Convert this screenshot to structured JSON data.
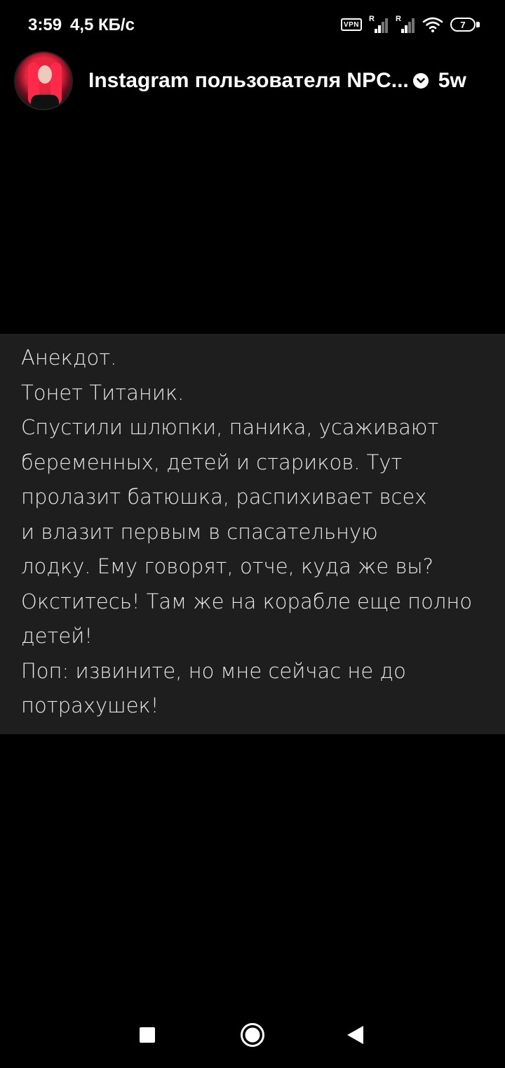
{
  "status_bar": {
    "time": "3:59",
    "speed": "4,5 КБ/с",
    "vpn_label": "VPN",
    "sim1_label": "R",
    "sim2_label": "R",
    "battery": "7"
  },
  "story": {
    "user": "Instagram пользователя NPC...",
    "age": "5w",
    "lines": [
      "Анекдот.",
      "Тонет Титаник.",
      "Спустили шлюпки, паника, усаживают",
      "беременных, детей и стариков. Тут",
      "пролазит батюшка, распихивает всех",
      "и влазит первым в спасательную",
      "лодку. Ему говорят, отче, куда же вы?",
      "Окститесь! Там же на корабле еще полно",
      "детей!",
      "Поп: извините, но мне сейчас не до",
      "потрахушек!"
    ]
  },
  "colors": {
    "background": "#000000",
    "panel": "#1e1e1e",
    "text": "#e6e6e6"
  },
  "icons": {
    "verified": "verified-badge-icon",
    "recents": "square-recents-icon",
    "home": "circle-home-icon",
    "back": "triangle-back-icon"
  }
}
